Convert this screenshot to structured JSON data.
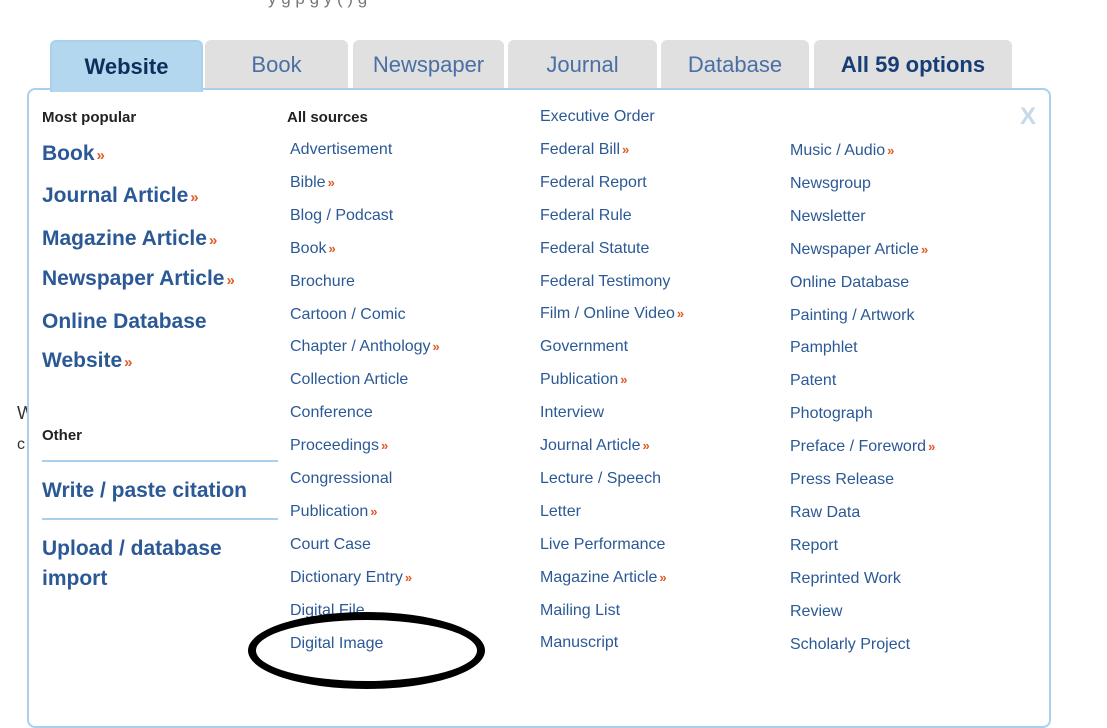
{
  "top_fragment": "y      g          p g      y       (    )          g",
  "background_letters": [
    "W",
    "c"
  ],
  "tabs": [
    "Website",
    "Book",
    "Newspaper",
    "Journal",
    "Database",
    "All 59 options"
  ],
  "close_label": "X",
  "headers": {
    "most_popular": "Most popular",
    "all_sources": "All sources",
    "other": "Other"
  },
  "arrow_glyph": "»",
  "popular": [
    {
      "label": "Book",
      "more": true
    },
    {
      "label": "Journal Article",
      "more": true
    },
    {
      "label": "Magazine Article",
      "more": true
    },
    {
      "label": "Newspaper Article",
      "more": true
    },
    {
      "label": "Online Database",
      "more": false
    },
    {
      "label": "Website",
      "more": true
    }
  ],
  "other": [
    "Write / paste citation",
    "Upload / database",
    "import"
  ],
  "columns": [
    [
      {
        "label": "Advertisement",
        "more": false
      },
      {
        "label": "Bible",
        "more": true
      },
      {
        "label": "Blog / Podcast",
        "more": false
      },
      {
        "label": "Book",
        "more": true
      },
      {
        "label": "Brochure",
        "more": false
      },
      {
        "label": "Cartoon / Comic",
        "more": false
      },
      {
        "label": "Chapter / Anthology",
        "more": true
      },
      {
        "label": "Collection Article",
        "more": false
      },
      {
        "label": "Conference",
        "more": false
      },
      {
        "label": "Proceedings",
        "more": true
      },
      {
        "label": "Congressional",
        "more": false
      },
      {
        "label": "Publication",
        "more": true
      },
      {
        "label": "Court Case",
        "more": false
      },
      {
        "label": "Dictionary Entry",
        "more": true
      },
      {
        "label": "Digital File",
        "more": false
      },
      {
        "label": "Digital Image",
        "more": false
      }
    ],
    [
      {
        "label": "Executive Order",
        "more": false
      },
      {
        "label": "Federal Bill",
        "more": true
      },
      {
        "label": "Federal Report",
        "more": false
      },
      {
        "label": "Federal Rule",
        "more": false
      },
      {
        "label": "Federal Statute",
        "more": false
      },
      {
        "label": "Federal Testimony",
        "more": false
      },
      {
        "label": "Film / Online Video",
        "more": true
      },
      {
        "label": "Government",
        "more": false
      },
      {
        "label": "Publication",
        "more": true
      },
      {
        "label": "Interview",
        "more": false
      },
      {
        "label": "Journal Article",
        "more": true
      },
      {
        "label": "Lecture / Speech",
        "more": false
      },
      {
        "label": "Letter",
        "more": false
      },
      {
        "label": "Live Performance",
        "more": false
      },
      {
        "label": "Magazine Article",
        "more": true
      },
      {
        "label": "Mailing List",
        "more": false
      },
      {
        "label": "Manuscript",
        "more": false
      }
    ],
    [
      {
        "label": "Music / Audio",
        "more": true
      },
      {
        "label": "Newsgroup",
        "more": false
      },
      {
        "label": "Newsletter",
        "more": false
      },
      {
        "label": "Newspaper Article",
        "more": true
      },
      {
        "label": "Online Database",
        "more": false
      },
      {
        "label": "Painting / Artwork",
        "more": false
      },
      {
        "label": "Pamphlet",
        "more": false
      },
      {
        "label": "Patent",
        "more": false
      },
      {
        "label": "Photograph",
        "more": false
      },
      {
        "label": "Preface / Foreword",
        "more": true
      },
      {
        "label": "Press Release",
        "more": false
      },
      {
        "label": "Raw Data",
        "more": false
      },
      {
        "label": "Report",
        "more": false
      },
      {
        "label": "Reprinted Work",
        "more": false
      },
      {
        "label": "Review",
        "more": false
      },
      {
        "label": "Scholarly Project",
        "more": false
      }
    ]
  ],
  "colors": {
    "tab_active_bg": "#b4d7f0",
    "tab_bg": "#e0e0e0",
    "link": "#2b5996",
    "arrow": "#e05a27",
    "border": "#a9d1ee"
  }
}
